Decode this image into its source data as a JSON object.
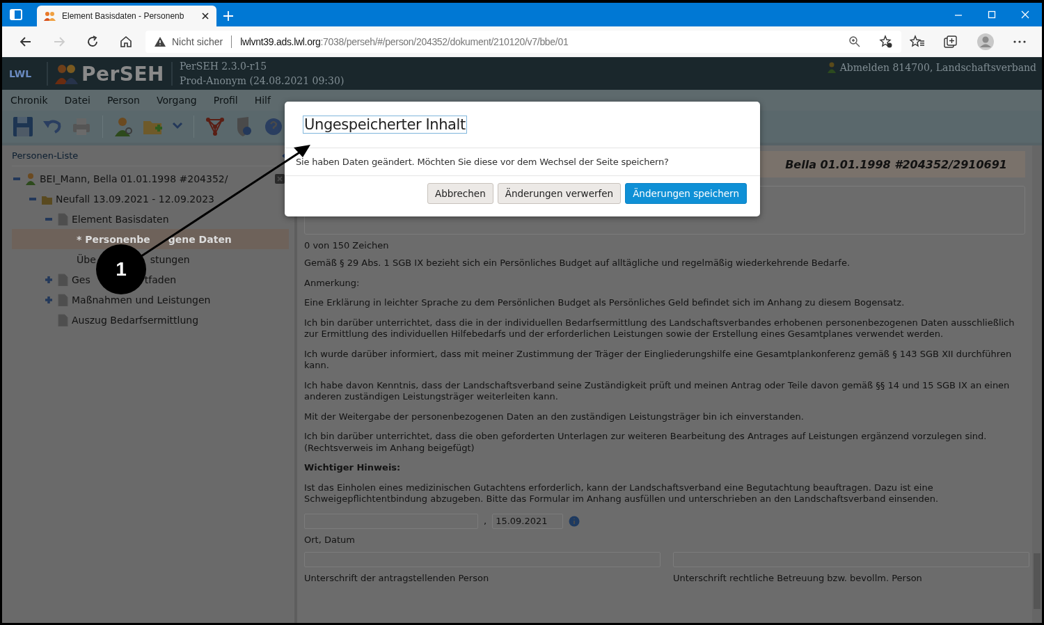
{
  "browser": {
    "tabs": [
      {
        "title": "Element Basisdaten - Personenb",
        "selected": true
      }
    ],
    "address": {
      "security": "Nicht sicher",
      "host": "lwlvnt39.ads.lwl.org",
      "path": ":7038/perseh/#/person/204352/dokument/210120/v7/bbe/01"
    }
  },
  "app_header": {
    "org": "LWL",
    "logo": "PerSEH",
    "version": "PerSEH 2.3.0-r15",
    "environment": "Prod-Anonym (24.08.2021 09:30)",
    "user": "Abmelden 814700, Landschaftsverband"
  },
  "menu": [
    "Chronik",
    "Datei",
    "Person",
    "Vorgang",
    "Profil",
    "Hilf"
  ],
  "sidebar": {
    "title": "Personen-Liste",
    "tree": [
      {
        "kind": "person",
        "label": "BEI_Mann, Bella 01.01.1998 #204352/",
        "expanded": true,
        "selected": false,
        "children": [
          {
            "kind": "case",
            "label": "Neufall 13.09.2021 - 12.09.2023",
            "expanded": true,
            "selected": false,
            "children": [
              {
                "kind": "document",
                "label": "Element Basisdaten",
                "expanded": true,
                "selected": false,
                "children": [
                  {
                    "kind": "page",
                    "label_parts": [
                      "* Personenbe",
                      "gene Daten"
                    ],
                    "selected": true
                  },
                  {
                    "kind": "page",
                    "label_parts": [
                      "Übe",
                      "stungen"
                    ],
                    "selected": false
                  }
                ]
              },
              {
                "kind": "document",
                "label_parts": [
                  "Ges",
                  "tfaden"
                ],
                "expanded": false,
                "selected": false
              },
              {
                "kind": "document",
                "label": "Maßnahmen und Leistungen",
                "expanded": false,
                "selected": false
              },
              {
                "kind": "document",
                "label": "Auszug Bedarfsermittlung",
                "selected": false
              }
            ]
          }
        ]
      }
    ]
  },
  "content": {
    "header": "Bella 01.01.1998 #204352/2910691",
    "char_count": "0 von 150 Zeichen",
    "paragraphs": [
      {
        "kind": "text",
        "text": "Gemäß § 29 Abs. 1 SGB IX bezieht sich ein Persönliches Budget auf alltägliche und regelmäßig wiederkehrende Bedarfe."
      },
      {
        "kind": "text",
        "text": "Anmerkung:"
      },
      {
        "kind": "text",
        "text": "Eine Erklärung in leichter Sprache zu dem Persönlichen Budget als Persönliches Geld befindet sich im Anhang zu diesem Bogensatz."
      },
      {
        "kind": "text",
        "text": "Ich bin darüber unterrichtet, dass die in der individuellen Bedarfsermittlung des Landschaftsverbandes erhobenen personenbezogenen Daten ausschließlich zur Ermittlung des individuellen Hilfebedarfs und der erforderlichen Leistungen sowie der Erstellung eines Gesamtplanes verwendet werden."
      },
      {
        "kind": "text",
        "text": "Ich wurde darüber informiert, dass mit meiner Zustimmung der Träger der Eingliederungshilfe eine Gesamtplankonferenz gemäß § 143 SGB XII durchführen kann."
      },
      {
        "kind": "text",
        "text": "Ich habe davon Kenntnis, dass der Landschaftsverband seine Zuständigkeit prüft und meinen Antrag oder Teile davon gemäß §§ 14 und 15 SGB IX an einen anderen zuständigen Leistungsträger weiterleiten kann."
      },
      {
        "kind": "text",
        "text": "Mit der Weitergabe der personenbezogenen Daten an den zuständigen Leistungsträger bin ich einverstanden."
      },
      {
        "kind": "text",
        "text": "Ich bin darüber unterrichtet, dass die oben geforderten Unterlagen zur weiteren Bearbeitung des Antrages auf Leistungen ergänzend vorzulegen sind. (Rechtsverweis im Anhang beigefügt)"
      },
      {
        "kind": "heading",
        "text": "Wichtiger Hinweis:"
      },
      {
        "kind": "text",
        "text": "Ist das Einholen eines medizinischen Gutachtens erforderlich, kann der Landschaftsverband eine Begutachtung beauftragen. Dazu ist eine Schweigepflichtentbindung abzugeben. Bitte das Formular im Anhang ausfüllen und unterschrieben an den Landschaftsverband einsenden."
      }
    ],
    "place_date": {
      "separator": ",",
      "date": "15.09.2021",
      "label": "Ort, Datum"
    },
    "signatures": [
      {
        "label": "Unterschrift der antragstellenden Person"
      },
      {
        "label": "Unterschrift rechtliche Betreuung bzw. bevollm. Person"
      }
    ]
  },
  "dialog": {
    "title": "Ungespeicherter Inhalt",
    "message": "Sie haben Daten geändert. Möchten Sie diese vor dem Wechsel der Seite speichern?",
    "buttons": [
      {
        "label": "Abbrechen",
        "kind": "default"
      },
      {
        "label": "Änderungen verwerfen",
        "kind": "default"
      },
      {
        "label": "Änderungen speichern",
        "kind": "primary"
      }
    ]
  },
  "callout": {
    "number": "1"
  }
}
